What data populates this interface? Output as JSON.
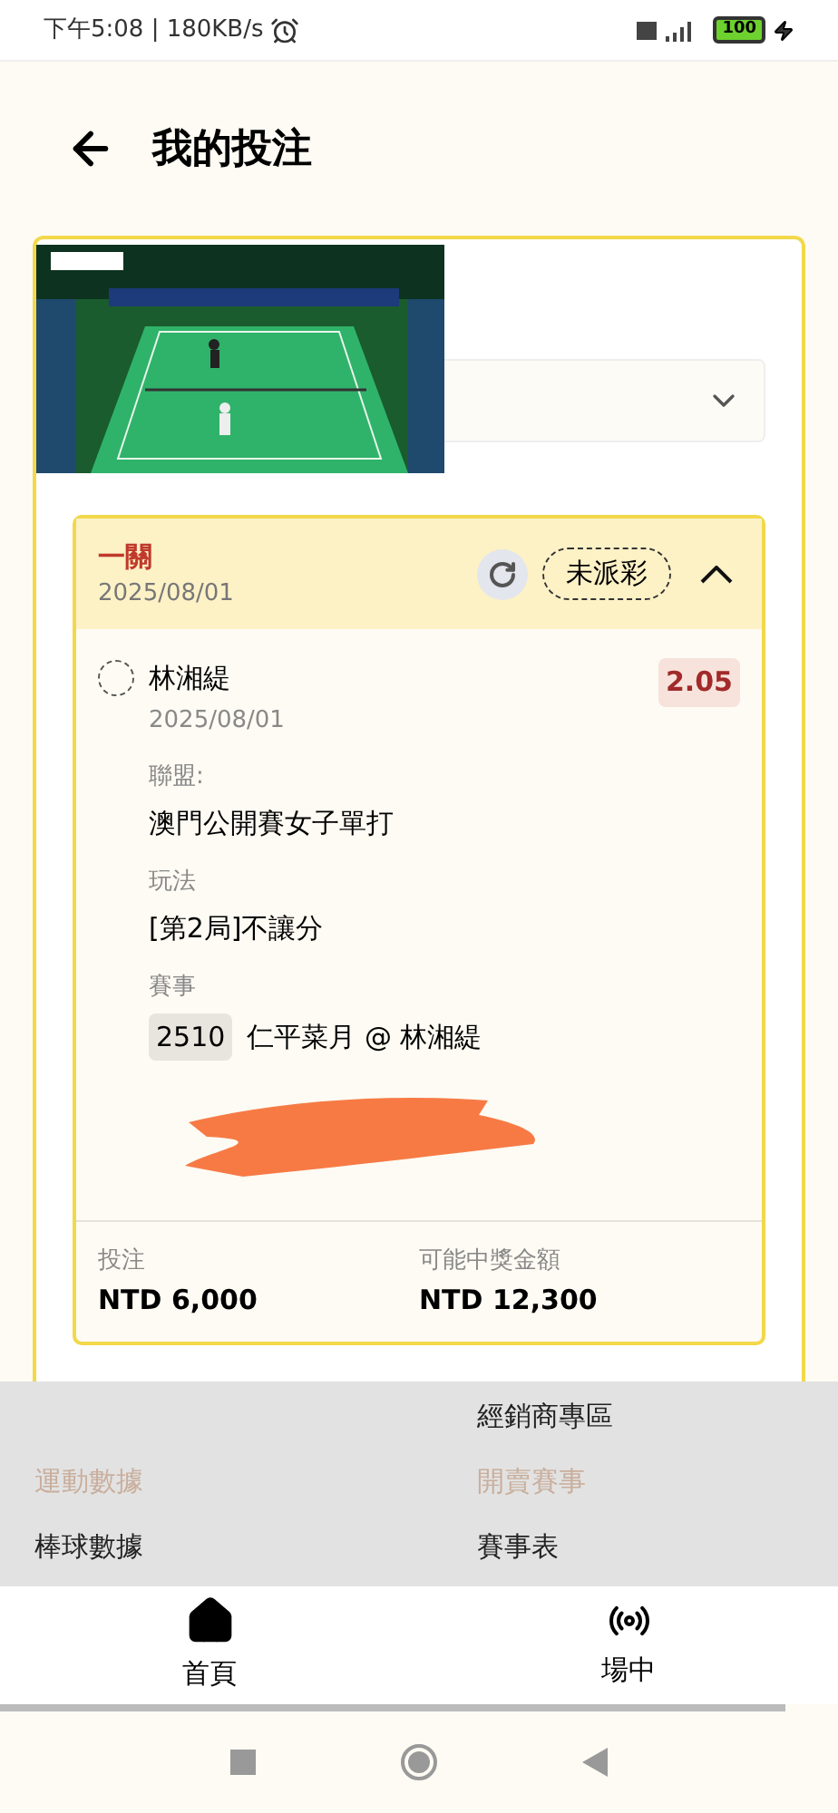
{
  "status_bar": {
    "time": "下午5:08 | 180KB/s",
    "battery": "100"
  },
  "header": {
    "title": "我的投注"
  },
  "bet_slip": {
    "title": "一關",
    "date": "2025/08/01",
    "status": "未派彩",
    "expanded": true,
    "selection": {
      "name": "林湘緹",
      "date": "2025/08/01",
      "odds": "2.05",
      "fields": [
        {
          "label": "聯盟:",
          "value": "澳門公開賽女子單打"
        },
        {
          "label": "玩法",
          "value": "[第2局]不讓分"
        }
      ],
      "event": {
        "label": "賽事",
        "code": "2510",
        "value": "仁平菜月 @ 林湘緹"
      }
    },
    "totals": [
      {
        "label": "投注",
        "value": "NTD 6,000"
      },
      {
        "label": "可能中獎金額",
        "value": "NTD 12,300"
      }
    ]
  },
  "menu": {
    "rows": [
      {
        "right": {
          "label": "經銷商專區",
          "kind": "link"
        }
      },
      {
        "left": {
          "label": "運動數據",
          "kind": "category"
        },
        "right": {
          "label": "開賣賽事",
          "kind": "category"
        }
      },
      {
        "left": {
          "label": "棒球數據",
          "kind": "link"
        },
        "right": {
          "label": "賽事表",
          "kind": "link"
        }
      }
    ]
  },
  "bottom_nav": [
    {
      "label": "首頁",
      "kind": "home"
    },
    {
      "label": "場中",
      "kind": "live"
    }
  ]
}
